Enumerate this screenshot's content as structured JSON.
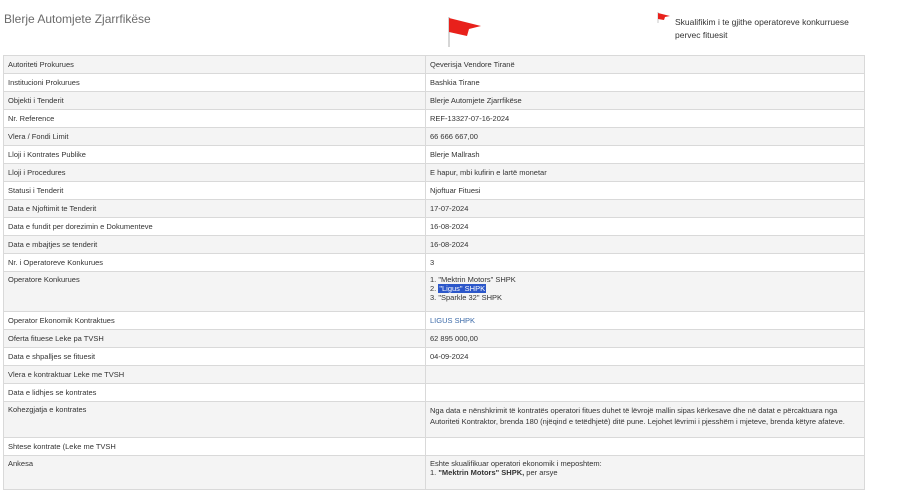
{
  "page": {
    "title": "Blerje Automjete Zjarrfikëse",
    "legend_text": "Skualifikim i te gjithe operatoreve konkurruese pervec fituesit",
    "flag_color": "#e8211b"
  },
  "rows": [
    {
      "label": "Autoriteti Prokurues",
      "value": "Qeverisja Vendore Tiranë"
    },
    {
      "label": "Institucioni Prokurues",
      "value": "Bashkia Tirane"
    },
    {
      "label": "Objekti i Tenderit",
      "value": "Blerje Automjete Zjarrfikëse"
    },
    {
      "label": "Nr. Reference",
      "value": "REF-13327-07-16-2024"
    },
    {
      "label": "Vlera / Fondi Limit",
      "value": "66 666 667,00"
    },
    {
      "label": "Lloji i Kontrates Publike",
      "value": "Blerje Mallrash"
    },
    {
      "label": "Lloji i Procedures",
      "value": "E hapur, mbi kufirin e lartë monetar"
    },
    {
      "label": "Statusi i Tenderit",
      "value": "Njoftuar Fituesi"
    },
    {
      "label": "Data e Njoftimit te Tenderit",
      "value": "17-07-2024"
    },
    {
      "label": "Data e fundit per dorezimin e Dokumenteve",
      "value": "16-08-2024"
    },
    {
      "label": "Data e mbajtjes se tenderit",
      "value": "16-08-2024"
    },
    {
      "label": "Nr. i Operatoreve Konkurues",
      "value": "3"
    }
  ],
  "operators": {
    "label": "Operatore Konkurues",
    "item1": "1. \"Mektrin Motors\" SHPK",
    "item2_prefix": "2. ",
    "item2_selected": "\"Ligus\" SHPK",
    "item3": "3. \"Sparkle 32\" SHPK"
  },
  "rows2": [
    {
      "label": "Operator Ekonomik Kontraktues",
      "value": "LIGUS SHPK"
    },
    {
      "label": "Oferta fituese Leke pa TVSH",
      "value": "62 895 000,00"
    },
    {
      "label": "Data e shpalljes se fituesit",
      "value": "04-09-2024"
    },
    {
      "label": "Vlera e kontraktuar Leke me TVSH",
      "value": ""
    },
    {
      "label": "Data e lidhjes se kontrates",
      "value": ""
    }
  ],
  "duration": {
    "label": "Kohezgjatja e kontrates",
    "value": "Nga data e nënshkrimit të kontratës operatori fitues duhet të lëvrojë mallin sipas kërkesave dhe në datat e përcaktuara nga Autoriteti Kontraktor, brenda 180 (njëqind e tetëdhjetë) ditë pune. Lejohet lëvrimi i pjesshëm i mjeteve, brenda këtyre afateve."
  },
  "extension": {
    "label": "Shtese kontrate (Leke me TVSH",
    "value": ""
  },
  "appeal": {
    "label": "Ankesa",
    "line1": "Eshte skualifikuar operatori ekonomik i meposhtem:",
    "line2_prefix": "1. ",
    "line2_bold": "\"Mektrin Motors\" SHPK,",
    "line2_suffix": " per arsye"
  }
}
